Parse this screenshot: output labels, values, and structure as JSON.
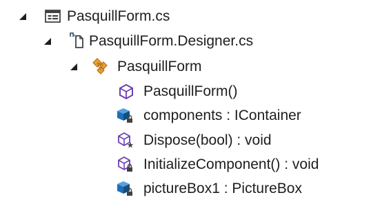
{
  "solution_explorer": {
    "nodes": [
      {
        "label": "PasquillForm.cs",
        "icon": "csharp-form-file-icon",
        "expanded": true,
        "level": 0
      },
      {
        "label": "PasquillForm.Designer.cs",
        "icon": "designer-file-icon",
        "expanded": true,
        "level": 1
      },
      {
        "label": "PasquillForm",
        "icon": "class-icon",
        "expanded": true,
        "level": 2
      },
      {
        "label": "PasquillForm()",
        "icon": "method-public-icon",
        "level": 3
      },
      {
        "label": "components : IContainer",
        "icon": "field-private-icon",
        "level": 3
      },
      {
        "label": "Dispose(bool) : void",
        "icon": "method-protected-icon",
        "level": 3
      },
      {
        "label": "InitializeComponent() : void",
        "icon": "method-private-icon",
        "level": 3
      },
      {
        "label": "pictureBox1 : PictureBox",
        "icon": "field-private-icon",
        "level": 3
      }
    ],
    "colors": {
      "text": "#1e1e1e",
      "expander": "#1e1e1e",
      "method": "#6c3fb5",
      "field": "#1f6fb8",
      "class": "#c27d0e",
      "lock": "#424242"
    }
  }
}
